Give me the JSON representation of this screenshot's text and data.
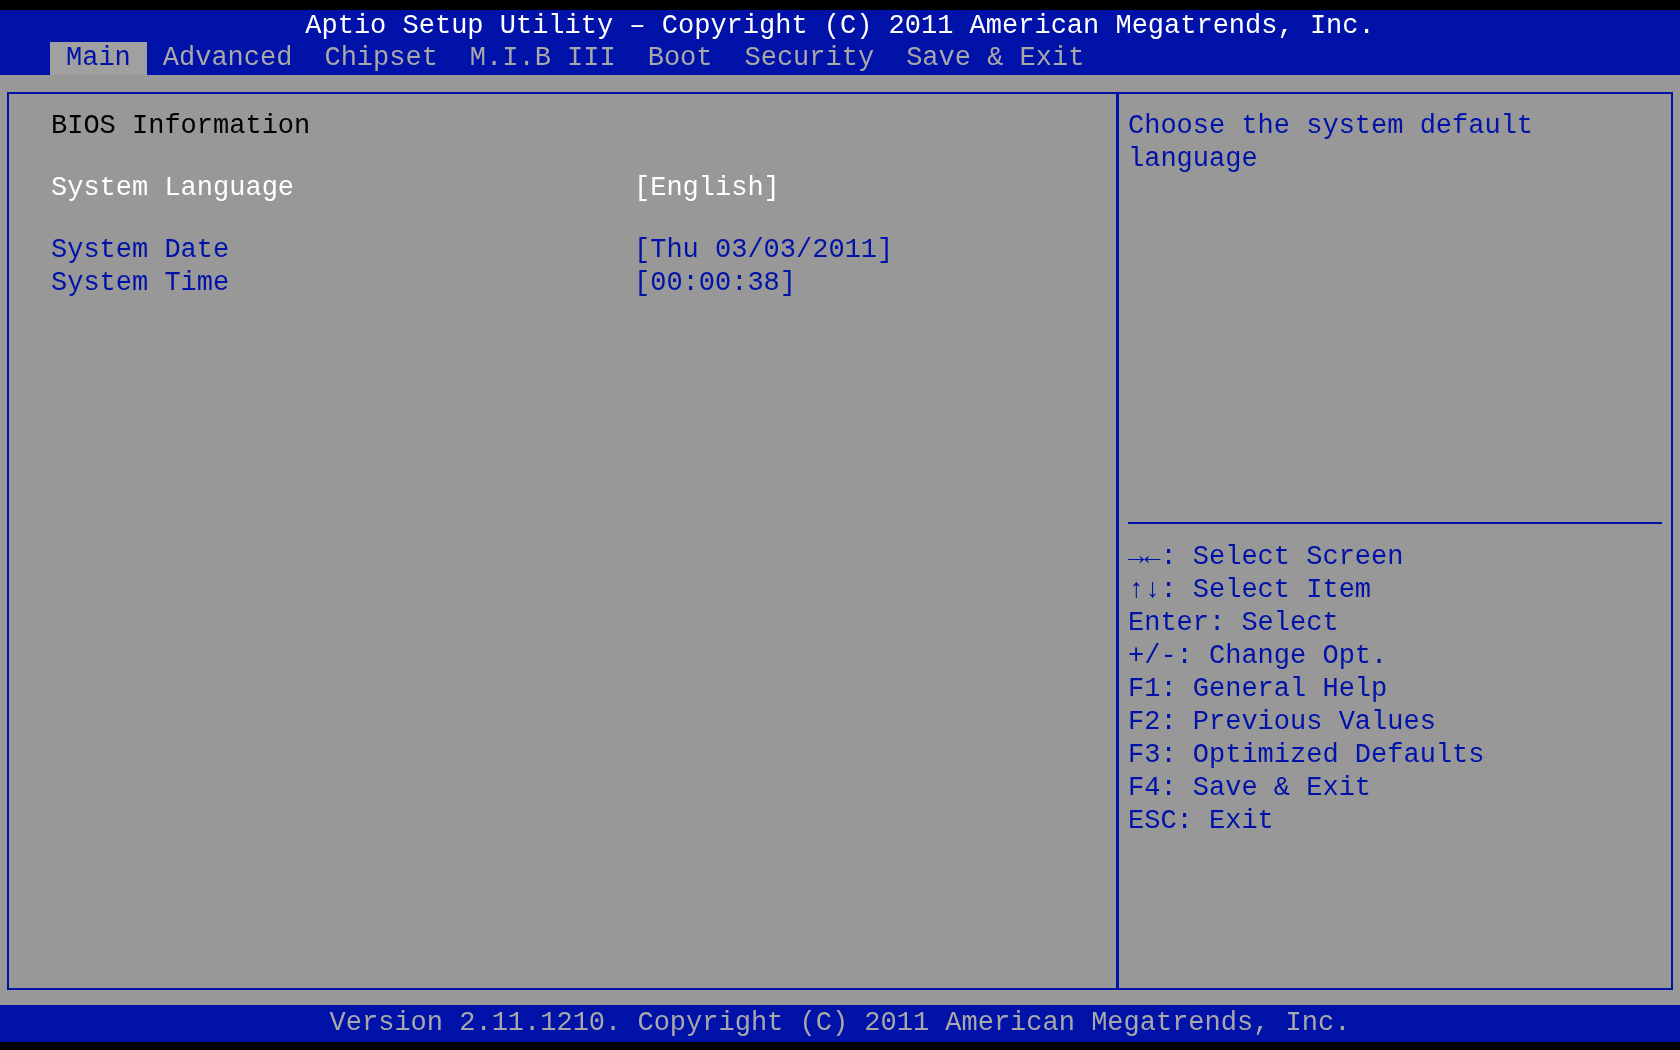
{
  "window": {
    "title": "Aptio Setup Utility – Copyright (C) 2011 American Megatrends, Inc."
  },
  "tabs": [
    {
      "label": "Main",
      "selected": true
    },
    {
      "label": "Advanced",
      "selected": false
    },
    {
      "label": "Chipset",
      "selected": false
    },
    {
      "label": "M.I.B III",
      "selected": false
    },
    {
      "label": "Boot",
      "selected": false
    },
    {
      "label": "Security",
      "selected": false
    },
    {
      "label": "Save & Exit",
      "selected": false
    }
  ],
  "settings": {
    "sections": [
      {
        "items": [
          {
            "kind": "header",
            "label": "BIOS Information"
          }
        ]
      },
      {
        "items": [
          {
            "kind": "option",
            "label": "System Language",
            "value": "[English]",
            "selected": true
          }
        ]
      },
      {
        "items": [
          {
            "kind": "option",
            "label": "System Date",
            "value": "[Thu 03/03/2011]",
            "selected": false
          },
          {
            "kind": "option",
            "label": "System Time",
            "value": "[00:00:38]",
            "selected": false
          }
        ]
      }
    ]
  },
  "help": {
    "description": "Choose the system default language",
    "keys": [
      "→←: Select Screen",
      "↑↓: Select Item",
      "Enter: Select",
      "+/-: Change Opt.",
      "F1: General Help",
      "F2: Previous Values",
      "F3: Optimized Defaults",
      "F4: Save & Exit",
      "ESC: Exit"
    ]
  },
  "status_bar": "Version 2.11.1210. Copyright (C) 2011 American Megatrends, Inc."
}
